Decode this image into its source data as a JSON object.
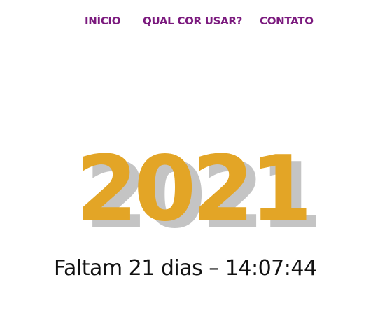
{
  "nav": {
    "items": [
      {
        "label": "INÍCIO"
      },
      {
        "label": "QUAL COR USAR?"
      },
      {
        "label": "CONTATO"
      }
    ]
  },
  "hero": {
    "year": "2021",
    "countdown": "Faltam 21 dias – 14:07:44"
  },
  "colors": {
    "nav_text": "#7b1a7e",
    "year_fill": "#e3a526",
    "year_shadow": "#c4c4c4",
    "countdown_text": "#111111",
    "background": "#ffffff"
  }
}
